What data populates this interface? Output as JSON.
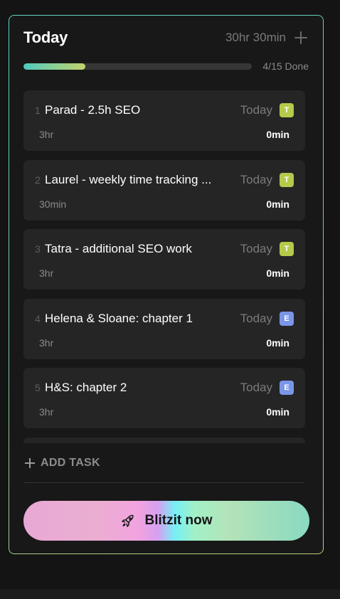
{
  "header": {
    "title": "Today",
    "total_time": "30hr 30min"
  },
  "progress": {
    "label": "4/15 Done",
    "fraction": 0.27
  },
  "tasks": [
    {
      "num": "1",
      "title": "Parad - 2.5h SEO",
      "when": "Today",
      "badge": "T",
      "badge_color": "#b6c94a",
      "estimate": "3hr",
      "spent": "0min"
    },
    {
      "num": "2",
      "title": "Laurel - weekly time tracking ...",
      "when": "Today",
      "badge": "T",
      "badge_color": "#b6c94a",
      "estimate": "30min",
      "spent": "0min"
    },
    {
      "num": "3",
      "title": "Tatra - additional SEO work",
      "when": "Today",
      "badge": "T",
      "badge_color": "#b6c94a",
      "estimate": "3hr",
      "spent": "0min"
    },
    {
      "num": "4",
      "title": "Helena & Sloane: chapter 1",
      "when": "Today",
      "badge": "E",
      "badge_color": "#7b96e8",
      "estimate": "3hr",
      "spent": "0min"
    },
    {
      "num": "5",
      "title": "H&S: chapter 2",
      "when": "Today",
      "badge": "E",
      "badge_color": "#7b96e8",
      "estimate": "3hr",
      "spent": "0min"
    }
  ],
  "add_task_label": "ADD TASK",
  "cta": {
    "label": "Blitzit now",
    "icon": "rocket-icon"
  }
}
